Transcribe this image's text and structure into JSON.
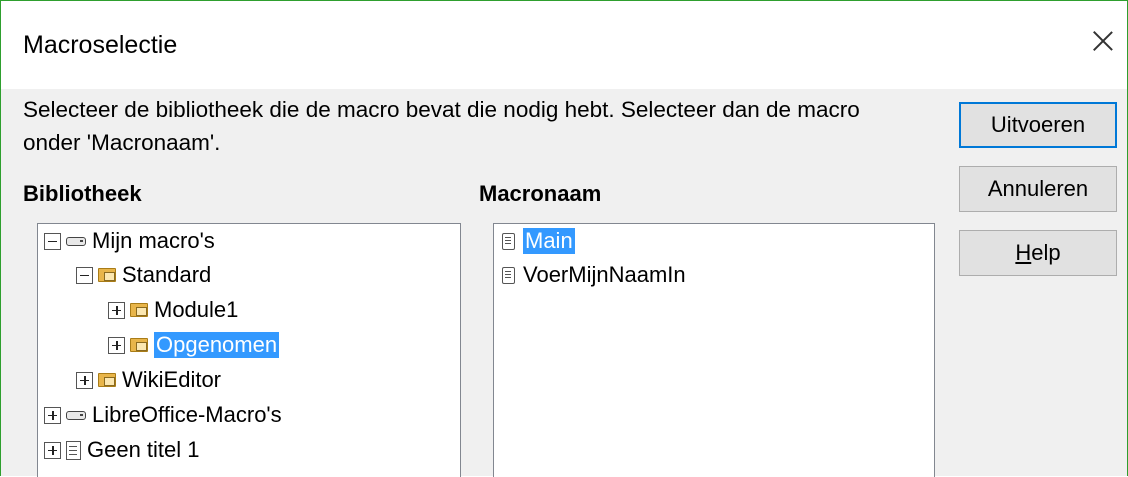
{
  "window": {
    "title": "Macroselectie",
    "close_icon": "close-icon"
  },
  "description": "Selecteer de bibliotheek die de macro bevat die nodig hebt. Selecteer dan de macro onder 'Macronaam'.",
  "library": {
    "label": "Bibliotheek",
    "items": [
      {
        "label": "Mijn macro's",
        "expander": "minus",
        "icon": "drive-icon",
        "level": 0,
        "selected": false
      },
      {
        "label": "Standard",
        "expander": "minus",
        "icon": "folder-icon",
        "level": 1,
        "selected": false
      },
      {
        "label": "Module1",
        "expander": "plus",
        "icon": "folder-icon",
        "level": 2,
        "selected": false
      },
      {
        "label": "Opgenomen",
        "expander": "plus",
        "icon": "folder-icon",
        "level": 2,
        "selected": true
      },
      {
        "label": "WikiEditor",
        "expander": "plus",
        "icon": "folder-icon",
        "level": 1,
        "selected": false
      },
      {
        "label": "LibreOffice-Macro's",
        "expander": "plus",
        "icon": "drive-icon",
        "level": 0,
        "selected": false
      },
      {
        "label": "Geen titel 1",
        "expander": "plus",
        "icon": "document-icon",
        "level": 0,
        "selected": false
      }
    ]
  },
  "macros": {
    "label": "Macronaam",
    "items": [
      {
        "label": "Main",
        "icon": "macro-icon",
        "selected": true
      },
      {
        "label": "VoerMijnNaamIn",
        "icon": "macro-icon",
        "selected": false
      }
    ]
  },
  "buttons": {
    "run": "Uitvoeren",
    "cancel": "Annuleren",
    "help_prefix": "",
    "help_mnemonic": "H",
    "help_rest": "elp"
  },
  "colors": {
    "selection": "#3399ff",
    "default_button_border": "#0078d7",
    "window_border": "#2e9f2e"
  }
}
